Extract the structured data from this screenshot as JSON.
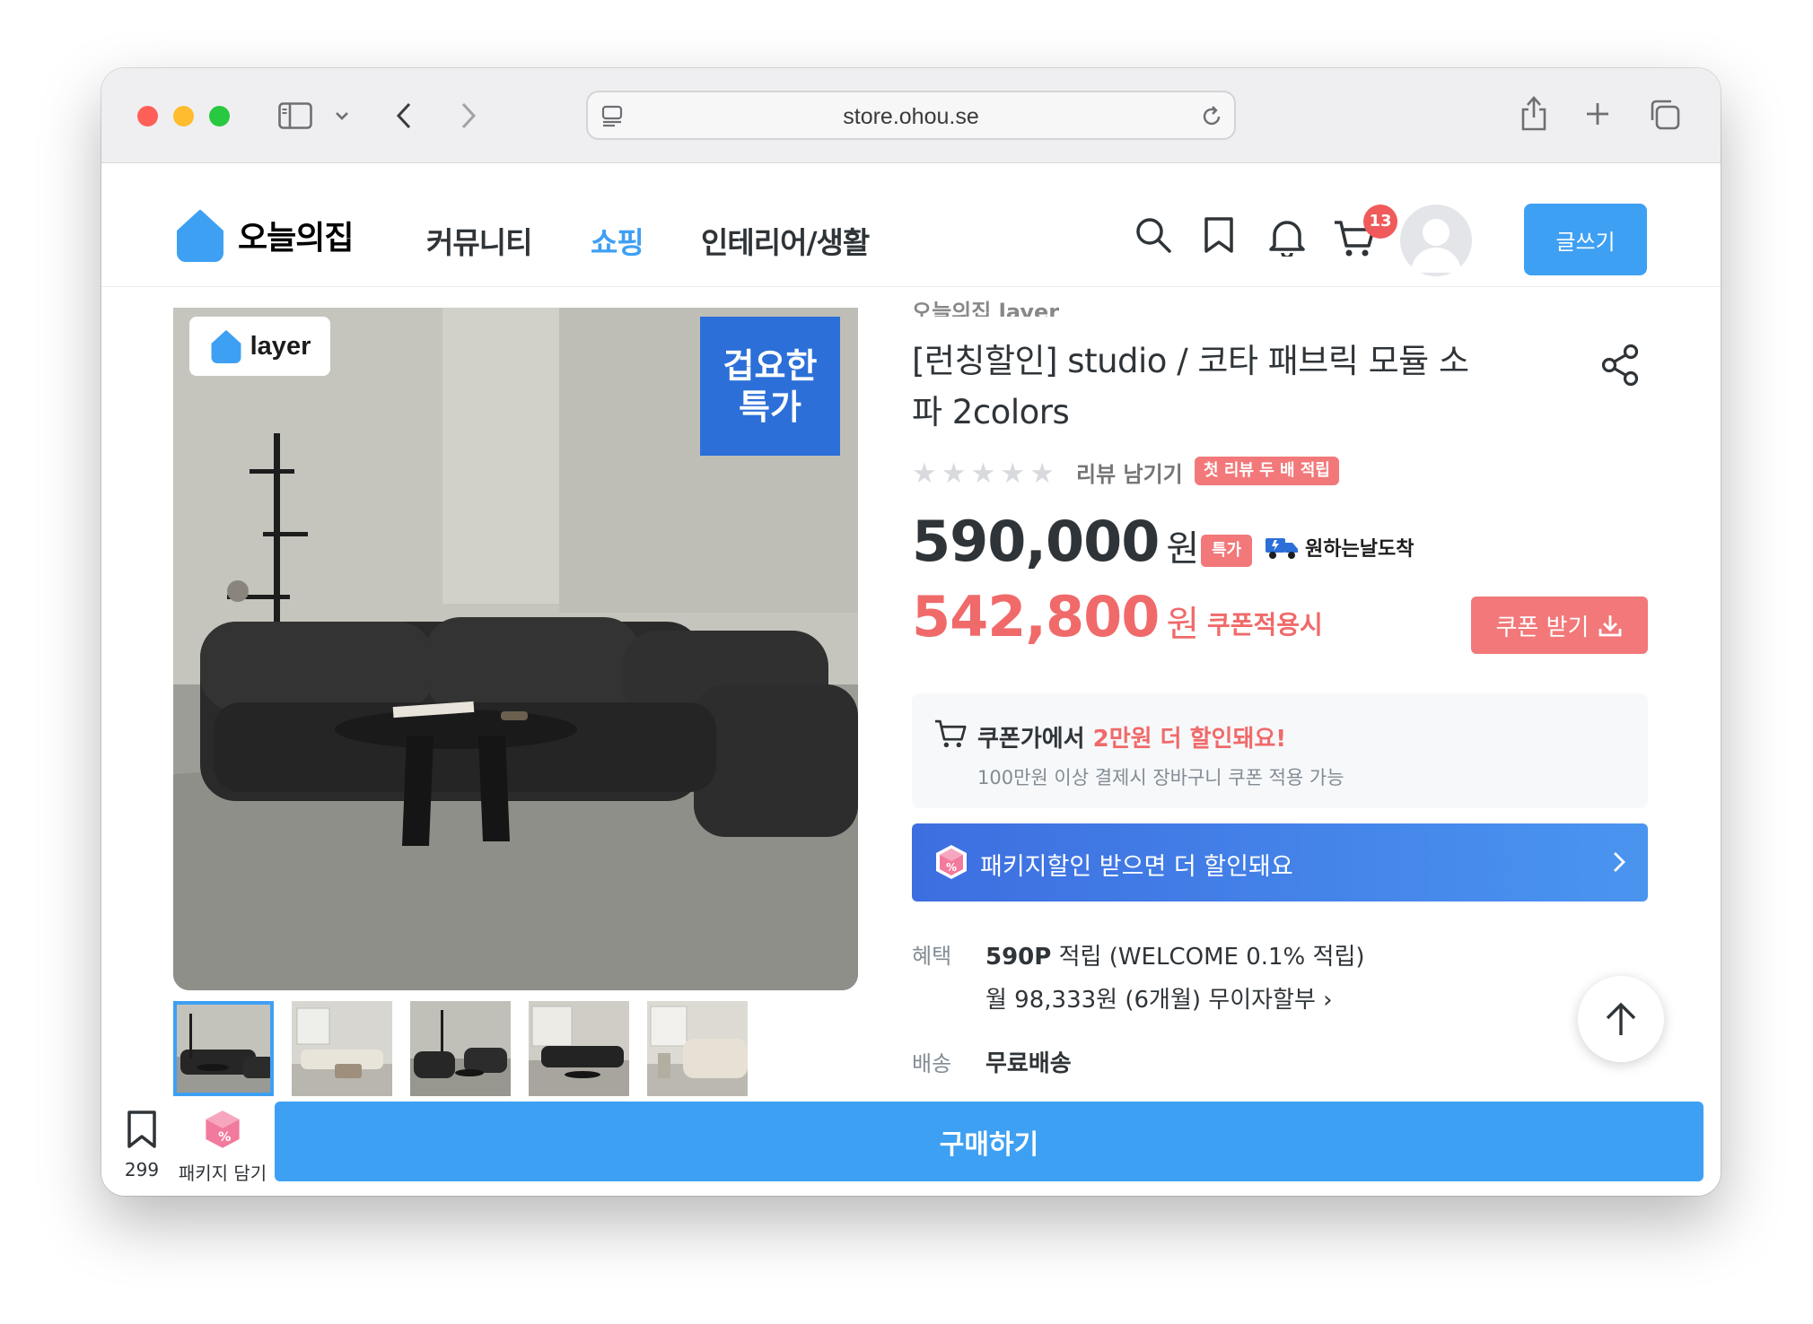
{
  "browser": {
    "url": "store.ohou.se"
  },
  "header": {
    "logo_text": "오늘의집",
    "nav": [
      {
        "label": "커뮤니티",
        "active": false
      },
      {
        "label": "쇼핑",
        "active": true
      },
      {
        "label": "인테리어/생활",
        "active": false
      }
    ],
    "cart_count": "13",
    "write_label": "글쓰기"
  },
  "gallery": {
    "layer_badge": "layer",
    "deal_badge_line1": "겁요한",
    "deal_badge_line2": "특가",
    "thumbnail_count": 5,
    "selected_index": 0
  },
  "product": {
    "brand": "오늘의집 layer",
    "title": "[런칭할인] studio / 코타 패브릭 모듈 소파 2colors",
    "rating_stars": 5,
    "review_link": "리뷰 남기기",
    "review_badge": "첫 리뷰 두 배 적립",
    "price_original": "590,000",
    "currency": "원",
    "special_badge": "특가",
    "delivery_badge": "원하는날도착",
    "price_coupon": "542,800",
    "coupon_note": "쿠폰적용시",
    "coupon_button": "쿠폰 받기",
    "info_prefix": "쿠폰가에서 ",
    "info_highlight": "2만원 더 할인돼요!",
    "info_sub": "100만원 이상 결제시 장바구니 쿠폰 적용 가능",
    "package_banner": "패키지할인 받으면 더 할인돼요",
    "benefit_label": "혜택",
    "benefit_points": "590P",
    "benefit_points_note": " 적립 (WELCOME 0.1% 적립)",
    "benefit_installment": "월 98,333원 (6개월) 무이자할부 ›",
    "shipping_label": "배송",
    "shipping_value": "무료배송"
  },
  "bottom_bar": {
    "bookmark_count": "299",
    "package_label": "패키지 담기",
    "buy_label": "구매하기"
  },
  "colors": {
    "accent_blue": "#3ea0f3",
    "sale_red": "#f06a6a",
    "deal_blue": "#2c6fd8"
  }
}
